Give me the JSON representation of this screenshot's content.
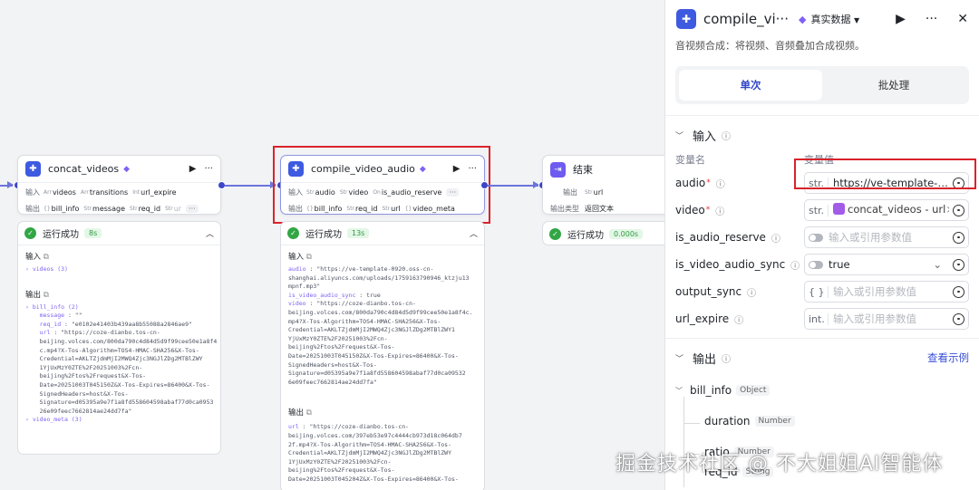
{
  "nodes": {
    "concat": {
      "title": "concat_videos",
      "input_label": "输入",
      "output_label": "输出",
      "inputs": [
        {
          "type": "Arr",
          "name": "videos"
        },
        {
          "type": "Arr",
          "name": "transitions"
        },
        {
          "type": "Int",
          "name": "url_expire"
        }
      ],
      "outputs": [
        {
          "type": "{}",
          "name": "bill_info"
        },
        {
          "type": "Str",
          "name": "message"
        },
        {
          "type": "Str",
          "name": "req_id"
        },
        {
          "type": "Str",
          "name": "ur"
        }
      ],
      "more": "···",
      "status": "运行成功",
      "time": "8s",
      "result_input_title": "输入",
      "result_output_title": "输出",
      "result_input": "› videos (3)",
      "result_output": [
        "› bill_info (2)",
        "    message : \"\"",
        "    req_id : \"e0102e41403b439aa8b55088a2846ae9\"",
        "    url : \"https://coze-dianbo.tos-cn-",
        "    beijing.volces.com/800da790c4d84d5d9f99cee50e1a8f4",
        "    c.mp4?X-Tos-Algorithm=TOS4-HMAC-SHA256&X-Tos-",
        "    Credential=AKLTZjdmMjI2MWQ4Zjc3NGJlZDg2MTBlZWY",
        "    1YjUxMzY0ZTE%2F20251003%2Fcn-",
        "    beijing%2Ftos%2Frequest&X-Tos-",
        "    Date=20251003T045150Z&X-Tos-Expires=86400&X-Tos-",
        "    SignedHeaders=host&X-Tos-",
        "    Signature=d05395a9e7f1a8fd558604598abaf77d0ca0953",
        "    26e09feec7662814ae24dd7fa\"",
        "› video_meta (3)"
      ]
    },
    "compile": {
      "title": "compile_video_audio",
      "input_label": "输入",
      "output_label": "输出",
      "inputs": [
        {
          "type": "Str",
          "name": "audio"
        },
        {
          "type": "Str",
          "name": "video"
        },
        {
          "type": "On",
          "name": "is_audio_reserve"
        }
      ],
      "outputs": [
        {
          "type": "{}",
          "name": "bill_info"
        },
        {
          "type": "Str",
          "name": "req_id"
        },
        {
          "type": "Str",
          "name": "url"
        },
        {
          "type": "{}",
          "name": "video_meta"
        }
      ],
      "more": "···",
      "status": "运行成功",
      "time": "13s",
      "result_input_title": "输入",
      "result_output_title": "输出",
      "result_input": [
        "audio : \"https://ve-template-0920.oss-cn-",
        "shanghai.aliyuncs.com/uploads/1759163790946_ktzju13",
        "mpnf.mp3\"",
        "is_video_audio_sync : true",
        "video : \"https://coze-dianbo.tos-cn-",
        "beijing.volces.com/800da790c4d84d5d9f99cee50e1a8f4c.",
        "mp4?X-Tos-Algorithm=TOS4-HMAC-SHA256&X-Tos-",
        "Credential=AKLTZjdmMjI2MWQ4Zjc3NGJlZDg2MTBlZWY1",
        "YjUxMzY0ZTE%2F20251003%2Fcn-",
        "beijing%2Ftos%2Frequest&X-Tos-",
        "Date=20251003T045150Z&X-Tos-Expires=86400&X-Tos-",
        "SignedHeaders=host&X-Tos-",
        "Signature=d05395a9e7f1a8fd558604598abaf77d0ca09532",
        "6e09feec7662814ae24dd7fa\""
      ],
      "result_output": [
        "url : \"https://coze-dianbo.tos-cn-",
        "beijing.volces.com/397eb53e97c4444cb973d18c064db7",
        "2f.mp4?X-Tos-Algorithm=TOS4-HMAC-SHA256&X-Tos-",
        "Credential=AKLTZjdmMjI2MWQ4Zjc3NGJlZDg2MTBlZWY",
        "1YjUxMzY0ZTE%2F20251003%2Fcn-",
        "beijing%2Ftos%2Frequest&X-Tos-",
        "Date=20251003T045204Z&X-Tos-Expires=86400&X-Tos-"
      ]
    },
    "end": {
      "title": "结束",
      "output_label": "输出",
      "output_type_label": "输出类型",
      "output": {
        "type": "Str",
        "name": "url"
      },
      "output_type": "返回文本",
      "status": "运行成功",
      "time": "0.000s"
    }
  },
  "side": {
    "title": "compile_vi···",
    "data_mode": "真实数据",
    "description": "音视频合成：将视频、音频叠加合成视频。",
    "tabs": [
      "单次",
      "批处理"
    ],
    "input_title": "输入",
    "col_name": "变量名",
    "col_value": "变量值",
    "params": [
      {
        "name": "audio",
        "required": "*",
        "type": "str.",
        "value": "https://ve-template-0···",
        "placeholder": false
      },
      {
        "name": "video",
        "required": "*",
        "type": "str.",
        "ref": "concat_videos - url",
        "placeholder": false
      },
      {
        "name": "is_audio_reserve",
        "required": "",
        "toggle": true,
        "value": "输入或引用参数值",
        "placeholder": true
      },
      {
        "name": "is_video_audio_sync",
        "required": "",
        "toggle": true,
        "value": "true",
        "placeholder": false,
        "dropdown": true
      },
      {
        "name": "output_sync",
        "required": "",
        "type": "{ }",
        "value": "输入或引用参数值",
        "placeholder": true
      },
      {
        "name": "url_expire",
        "required": "",
        "type": "int.",
        "value": "输入或引用参数值",
        "placeholder": true
      }
    ],
    "output_title": "输出",
    "view_example": "查看示例",
    "outputs": [
      {
        "name": "bill_info",
        "type": "Object"
      },
      {
        "name": "duration",
        "type": "Number"
      },
      {
        "name": "ratio",
        "type": "Number"
      },
      {
        "name": "req_id",
        "type": "String"
      }
    ]
  },
  "watermark": "掘金技术社区 @ 不大姐姐AI智能体",
  "colors": {
    "accent": "#3a50d6",
    "success": "#32a645",
    "highlight": "#d9232b",
    "badge": "#7f62f3"
  }
}
